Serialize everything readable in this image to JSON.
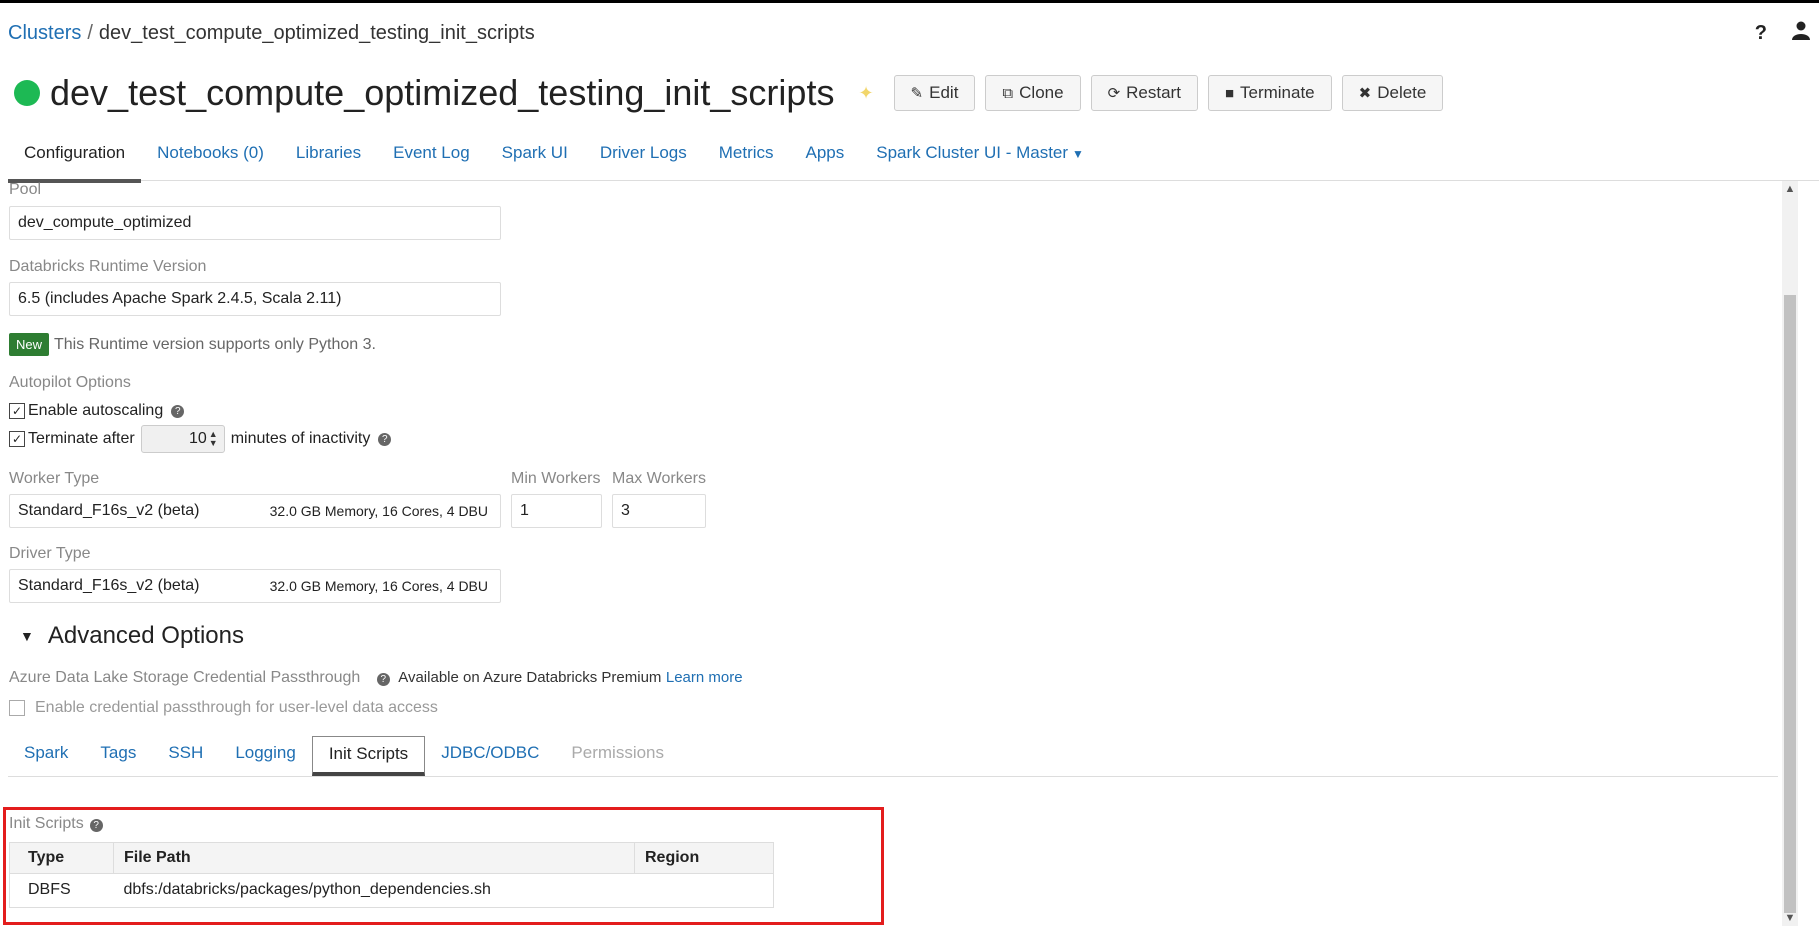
{
  "breadcrumb": {
    "root": "Clusters",
    "separator": "/",
    "current": "dev_test_compute_optimized_testing_init_scripts"
  },
  "header": {
    "title": "dev_test_compute_optimized_testing_init_scripts",
    "help_icon": "?",
    "buttons": {
      "edit": "Edit",
      "clone": "Clone",
      "restart": "Restart",
      "terminate": "Terminate",
      "delete": "Delete"
    }
  },
  "tabs": [
    "Configuration",
    "Notebooks (0)",
    "Libraries",
    "Event Log",
    "Spark UI",
    "Driver Logs",
    "Metrics",
    "Apps",
    "Spark Cluster UI - Master"
  ],
  "pool": {
    "label": "Pool",
    "value": "dev_compute_optimized"
  },
  "runtime": {
    "label": "Databricks Runtime Version",
    "value": "6.5 (includes Apache Spark 2.4.5, Scala 2.11)",
    "badge": "New",
    "note": "This Runtime version supports only Python 3."
  },
  "autopilot": {
    "label": "Autopilot Options",
    "autoscaling": "Enable autoscaling",
    "terminate_after": "Terminate after",
    "minutes": "10",
    "inactivity": "minutes of inactivity"
  },
  "worker": {
    "label": "Worker Type",
    "value": "Standard_F16s_v2 (beta)",
    "spec": "32.0 GB Memory, 16 Cores, 4 DBU",
    "min_label": "Min Workers",
    "min_value": "1",
    "max_label": "Max Workers",
    "max_value": "3"
  },
  "driver": {
    "label": "Driver Type",
    "value": "Standard_F16s_v2 (beta)",
    "spec": "32.0 GB Memory, 16 Cores, 4 DBU"
  },
  "advanced": {
    "title": "Advanced Options",
    "passthrough_label": "Azure Data Lake Storage Credential Passthrough",
    "premium_note": "Available on Azure Databricks Premium",
    "learn_more": "Learn more",
    "passthrough_checkbox": "Enable credential passthrough for user-level data access"
  },
  "subtabs": [
    "Spark",
    "Tags",
    "SSH",
    "Logging",
    "Init Scripts",
    "JDBC/ODBC",
    "Permissions"
  ],
  "init_scripts": {
    "label": "Init Scripts",
    "columns": [
      "Type",
      "File Path",
      "Region"
    ],
    "rows": [
      {
        "type": "DBFS",
        "path": "dbfs:/databricks/packages/python_dependencies.sh",
        "region": ""
      }
    ]
  },
  "colors": {
    "accent": "#1f6fb3",
    "status": "#1db954",
    "new_badge": "#2e7d32",
    "highlight": "#e31d1d"
  }
}
